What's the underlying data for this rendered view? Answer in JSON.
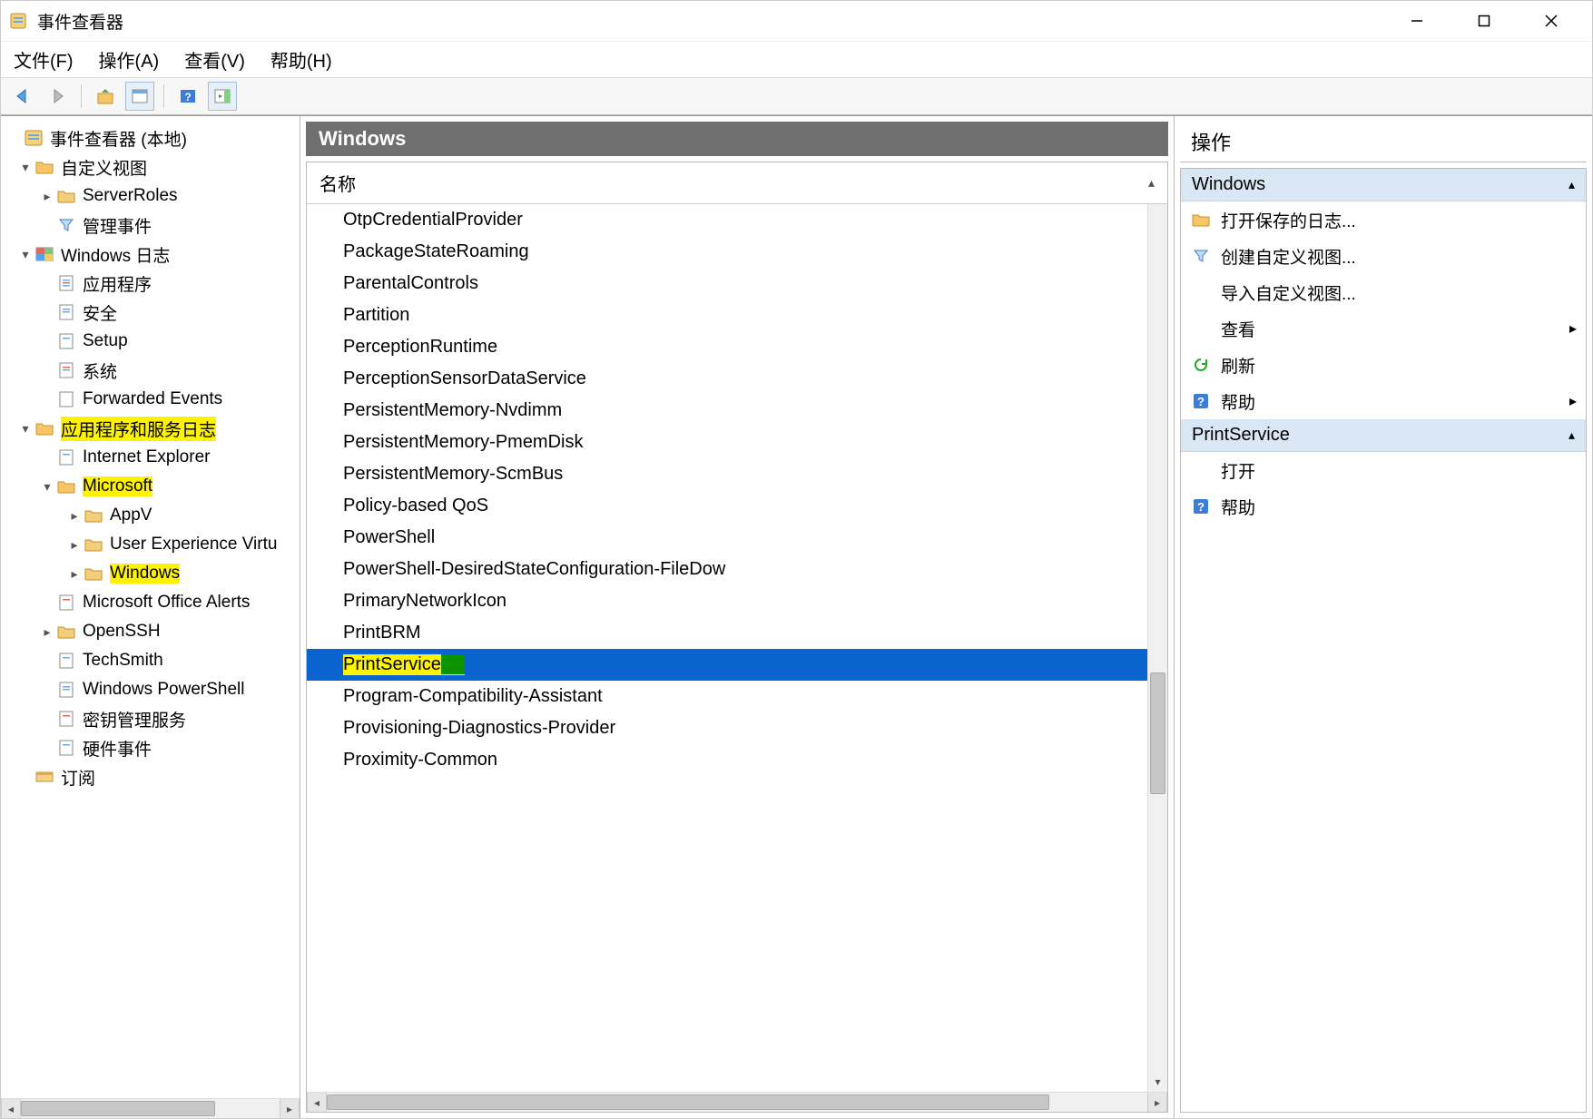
{
  "title": "事件查看器",
  "menubar": [
    "文件(F)",
    "操作(A)",
    "查看(V)",
    "帮助(H)"
  ],
  "tree": {
    "root": "事件查看器 (本地)",
    "custom_views": {
      "label": "自定义视图",
      "children": [
        "ServerRoles",
        "管理事件"
      ]
    },
    "windows_logs": {
      "label": "Windows 日志",
      "children": [
        "应用程序",
        "安全",
        "Setup",
        "系统",
        "Forwarded Events"
      ]
    },
    "app_services": {
      "label": "应用程序和服务日志",
      "children_top": [
        "Internet Explorer"
      ],
      "microsoft": {
        "label": "Microsoft",
        "children": [
          "AppV",
          "User Experience Virtu",
          "Windows"
        ]
      },
      "children_bottom": [
        "Microsoft Office Alerts",
        "OpenSSH",
        "TechSmith",
        "Windows PowerShell",
        "密钥管理服务",
        "硬件事件"
      ]
    },
    "subscriptions": "订阅"
  },
  "center": {
    "header": "Windows",
    "col_name": "名称",
    "items": [
      "OtpCredentialProvider",
      "PackageStateRoaming",
      "ParentalControls",
      "Partition",
      "PerceptionRuntime",
      "PerceptionSensorDataService",
      "PersistentMemory-Nvdimm",
      "PersistentMemory-PmemDisk",
      "PersistentMemory-ScmBus",
      "Policy-based QoS",
      "PowerShell",
      "PowerShell-DesiredStateConfiguration-FileDow",
      "PrimaryNetworkIcon",
      "PrintBRM",
      "PrintService",
      "Program-Compatibility-Assistant",
      "Provisioning-Diagnostics-Provider",
      "Proximity-Common"
    ],
    "selected_index": 14
  },
  "actions": {
    "header": "操作",
    "section1": {
      "title": "Windows",
      "items": [
        {
          "icon": "folder-open",
          "label": "打开保存的日志..."
        },
        {
          "icon": "filter",
          "label": "创建自定义视图..."
        },
        {
          "icon": "none",
          "label": "导入自定义视图..."
        },
        {
          "icon": "none",
          "label": "查看",
          "arrow": true
        },
        {
          "icon": "refresh",
          "label": "刷新"
        },
        {
          "icon": "help",
          "label": "帮助",
          "arrow": true
        }
      ]
    },
    "section2": {
      "title": "PrintService",
      "items": [
        {
          "icon": "none",
          "label": "打开"
        },
        {
          "icon": "help",
          "label": "帮助"
        }
      ]
    }
  }
}
